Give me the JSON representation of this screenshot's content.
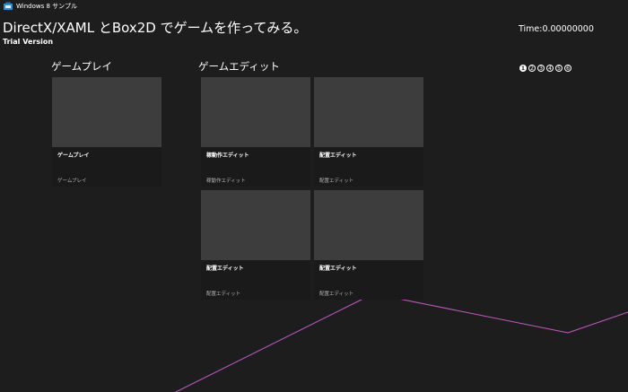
{
  "window": {
    "title": "Windows 8 サンプル"
  },
  "header": {
    "title": "DirectX/XAML とBox2D でゲームを作ってみる。",
    "edition": "Trial Version",
    "time": "Time:0.00000000"
  },
  "pager": {
    "pages": [
      "1",
      "2",
      "3",
      "4",
      "5",
      "6"
    ],
    "active_index": 0
  },
  "groups": [
    {
      "header": "ゲームプレイ",
      "tiles": [
        {
          "title": "ゲームプレイ",
          "subtitle": "ゲームプレイ"
        }
      ]
    },
    {
      "header": "ゲームエディット",
      "tiles": [
        {
          "title": "稼動作エディット",
          "subtitle": "稼動作エディット"
        },
        {
          "title": "配置エディット",
          "subtitle": "配置エディット"
        },
        {
          "title": "配置エディット",
          "subtitle": "配置エディット"
        },
        {
          "title": "配置エディット",
          "subtitle": "配置エディット"
        }
      ]
    }
  ],
  "colors": {
    "background": "#1d1d1d",
    "tile_image": "#3d3d3d",
    "tile_caption": "#1a1a1a",
    "line": "#c25bc4",
    "icon": "#2b8fd6"
  }
}
